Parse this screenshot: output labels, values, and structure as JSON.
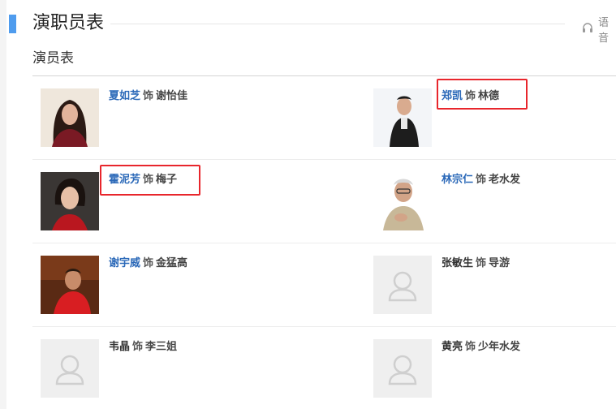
{
  "section": {
    "title": "演职员表",
    "voice_label": "语音",
    "subsection_title": "演员表"
  },
  "cast": [
    {
      "actor": "夏如芝",
      "as_word": "饰",
      "role": "谢怡佳",
      "linked": true,
      "photo": "actor-photo"
    },
    {
      "actor": "郑凯",
      "as_word": "饰",
      "role": "林德",
      "linked": true,
      "photo": "actor-photo",
      "highlighted": true
    },
    {
      "actor": "霍泥芳",
      "as_word": "饰",
      "role": "梅子",
      "linked": true,
      "photo": "actor-photo",
      "highlighted": true
    },
    {
      "actor": "林宗仁",
      "as_word": "饰",
      "role": "老水发",
      "linked": true,
      "photo": "actor-photo"
    },
    {
      "actor": "谢宇威",
      "as_word": "饰",
      "role": "金猛高",
      "linked": true,
      "photo": "actor-photo"
    },
    {
      "actor": "张敏生",
      "as_word": "饰",
      "role": "导游",
      "linked": false,
      "photo": "placeholder-avatar"
    },
    {
      "actor": "韦晶",
      "as_word": "饰",
      "role": "李三姐",
      "linked": false,
      "photo": "placeholder-avatar"
    },
    {
      "actor": "黄亮",
      "as_word": "饰",
      "role": "少年水发",
      "linked": false,
      "photo": "placeholder-avatar"
    }
  ],
  "colors": {
    "accent": "#4f9cee",
    "link": "#2a68b8",
    "annotation": "#e8262c"
  }
}
